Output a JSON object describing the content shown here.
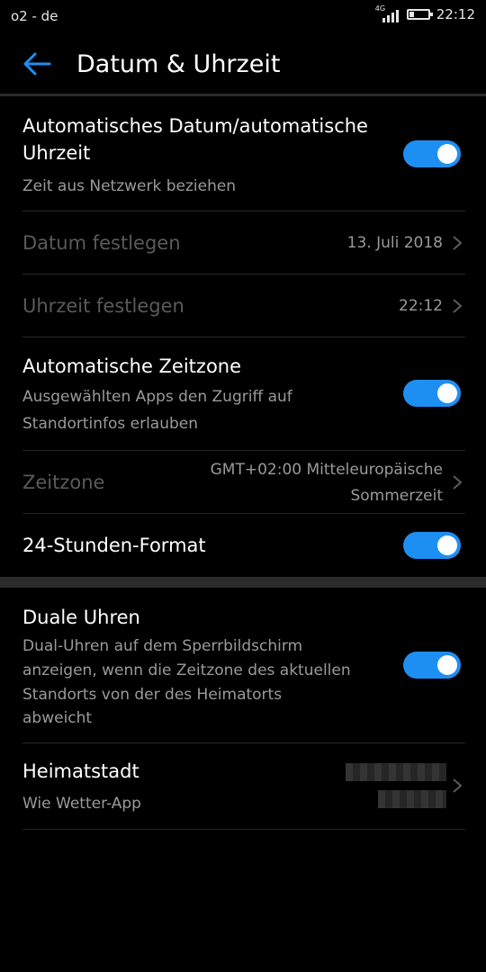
{
  "status_bar": {
    "carrier": "o2 - de",
    "network_tag": "4G",
    "time": "22:12"
  },
  "header": {
    "title": "Datum & Uhrzeit"
  },
  "settings": {
    "auto_datetime": {
      "label_line1": "Automatisches Datum/automatische",
      "label_line2": "Uhrzeit",
      "subtitle": "Zeit aus Netzwerk beziehen",
      "enabled": true
    },
    "set_date": {
      "label": "Datum festlegen",
      "value": "13. Juli 2018"
    },
    "set_time": {
      "label": "Uhrzeit festlegen",
      "value": "22:12"
    },
    "auto_timezone": {
      "label": "Automatische Zeitzone",
      "subtitle_line1": "Ausgewählten Apps den Zugriff auf",
      "subtitle_line2": "Standortinfos erlauben",
      "enabled": true
    },
    "timezone": {
      "label": "Zeitzone",
      "value_line1": "GMT+02:00 Mitteleuropäische",
      "value_line2": "Sommerzeit"
    },
    "format_24h": {
      "label": "24-Stunden-Format",
      "enabled": true
    },
    "dual_clocks": {
      "label": "Duale Uhren",
      "subtitle_line1": "Dual-Uhren auf dem Sperrbildschirm",
      "subtitle_line2": "anzeigen, wenn die Zeitzone des aktuellen",
      "subtitle_line3": "Standorts von der des Heimatorts",
      "subtitle_line4": "abweicht",
      "enabled": true
    },
    "home_city": {
      "label": "Heimatstadt",
      "subtitle": "Wie Wetter-App"
    }
  },
  "colors": {
    "accent": "#1e8ff2",
    "background": "#000000",
    "disabled_text": "#5a5a5a",
    "secondary_text": "#9a9a9a"
  }
}
